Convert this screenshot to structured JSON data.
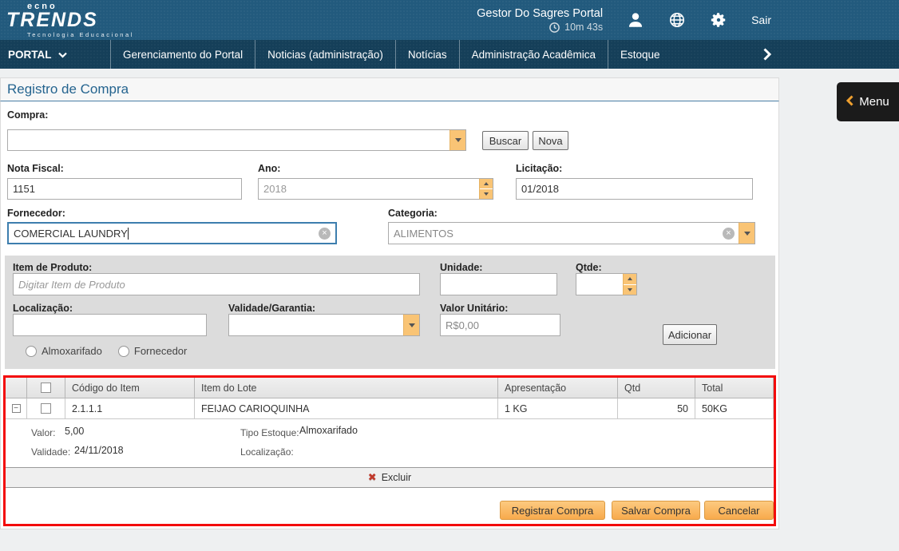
{
  "header": {
    "logo": {
      "line1": "ecno",
      "line2": "TRENDS",
      "tagline": "Tecnologia Educacional"
    },
    "portal_title": "Gestor Do Sagres Portal",
    "session_timer": "10m 43s",
    "logout_label": "Sair"
  },
  "nav": {
    "portal_label": "PORTAL",
    "items": [
      "Gerenciamento do Portal",
      "Noticias (administração)",
      "Notícias",
      "Administração Acadêmica",
      "Estoque"
    ]
  },
  "menu_button": {
    "label": "Menu"
  },
  "page": {
    "title": "Registro de Compra"
  },
  "form": {
    "compra": {
      "label": "Compra:",
      "value": ""
    },
    "buscar_label": "Buscar",
    "nova_label": "Nova",
    "nota_fiscal": {
      "label": "Nota Fiscal:",
      "value": "1151"
    },
    "ano": {
      "label": "Ano:",
      "value": "2018"
    },
    "licitacao": {
      "label": "Licitação:",
      "value": "01/2018"
    },
    "fornecedor": {
      "label": "Fornecedor:",
      "value": "COMERCIAL LAUNDRY",
      "word1": "COMERCIAL",
      "word2": "LAUNDRY"
    },
    "categoria": {
      "label": "Categoria:",
      "value": "ALIMENTOS"
    },
    "item_produto": {
      "label": "Item de Produto:",
      "placeholder": "Digitar Item de Produto",
      "value": ""
    },
    "unidade": {
      "label": "Unidade:",
      "value": ""
    },
    "qtde": {
      "label": "Qtde:",
      "value": ""
    },
    "localizacao": {
      "label": "Localização:",
      "value": ""
    },
    "validade_garantia": {
      "label": "Validade/Garantia:",
      "value": ""
    },
    "valor_unitario": {
      "label": "Valor Unitário:",
      "value": "R$0,00"
    },
    "adicionar_label": "Adicionar",
    "radio_almoxarifado": "Almoxarifado",
    "radio_fornecedor": "Fornecedor"
  },
  "grid": {
    "headers": [
      "Código do Item",
      "Item do Lote",
      "Apresentação",
      "Qtd",
      "Total"
    ],
    "rows": [
      {
        "codigo": "2.1.1.1",
        "item_lote": "FEIJAO CARIOQUINHA",
        "apresentacao": "1 KG",
        "qtd": "50",
        "total": "50KG"
      }
    ],
    "detail": {
      "valor_label": "Valor:",
      "valor": "5,00",
      "tipo_estoque_label": "Tipo Estoque:",
      "tipo_estoque": "Almoxarifado",
      "validade_label": "Validade:",
      "validade": "24/11/2018",
      "localizacao_label": "Localização:",
      "localizacao": ""
    },
    "excluir_label": "Excluir"
  },
  "actions": {
    "registrar_label": "Registrar Compra",
    "salvar_label": "Salvar Compra",
    "cancelar_label": "Cancelar"
  }
}
